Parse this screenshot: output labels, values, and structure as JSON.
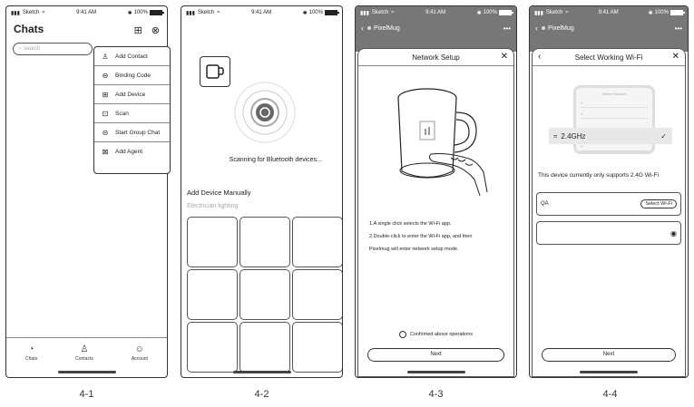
{
  "status": {
    "carrier": "Sketch",
    "time": "9:41 AM",
    "battery": "100%"
  },
  "captions": [
    "4-1",
    "4-2",
    "4-3",
    "4-4"
  ],
  "screen1": {
    "title": "Chats",
    "search_placeholder": "search",
    "menu": [
      {
        "label": "Add Contact",
        "icon": "add-contact-icon"
      },
      {
        "label": "Binding Code",
        "icon": "link-icon"
      },
      {
        "label": "Add Device",
        "icon": "plus-box-icon"
      },
      {
        "label": "Scan",
        "icon": "scan-icon"
      },
      {
        "label": "Start Group Chat",
        "icon": "group-chat-icon"
      },
      {
        "label": "Add Agent",
        "icon": "agent-icon"
      }
    ],
    "tabs": [
      "Chats",
      "Contacts",
      "Account"
    ]
  },
  "screen2": {
    "scanning_text": "Scanning for Bluetooth devices...",
    "add_manually": "Add Device Manually",
    "category": "Electrician lighting"
  },
  "screen3": {
    "app_name": "PixelMug",
    "sheet_title": "Network Setup",
    "instructions": [
      "1.A single click selects the Wi-Fi app.",
      "2.Double-click to enter the Wi-Fi app, and then",
      "Pixelmug will enter network setup mode."
    ],
    "confirm_label": "Confirmed above operations",
    "next_label": "Next"
  },
  "screen4": {
    "app_name": "PixelMug",
    "sheet_title": "Select Working Wi-Fi",
    "panel_title": "Select Network",
    "band_selected": "2.4GHz",
    "support_text": "This device currently only supports 2.4G Wi-Fi",
    "ssid": "QA",
    "select_wifi_label": "Select Wi-Fi",
    "next_label": "Next"
  }
}
